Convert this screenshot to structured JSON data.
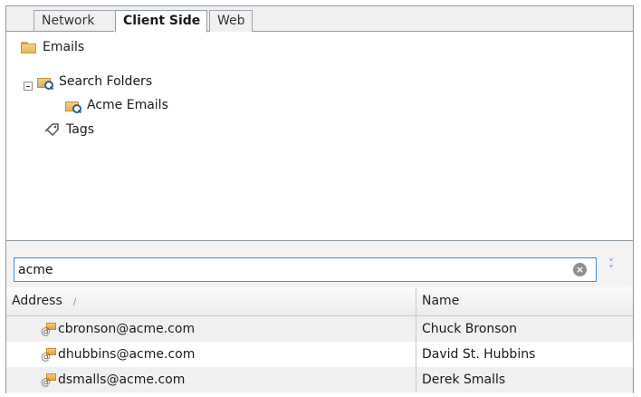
{
  "tabs": [
    {
      "label": "Network",
      "active": false
    },
    {
      "label": "Client Side",
      "active": true
    },
    {
      "label": "Web",
      "active": false
    }
  ],
  "tree": {
    "items": [
      {
        "label": "Emails",
        "icon": "folder-icon"
      },
      {
        "label": "Search Folders",
        "icon": "search-folder-icon",
        "expanded": true
      },
      {
        "label": "Acme Emails",
        "icon": "search-folder-icon"
      },
      {
        "label": "Tags",
        "icon": "tag-icon"
      }
    ]
  },
  "search": {
    "value": "acme"
  },
  "table": {
    "columns": [
      {
        "label": "Address",
        "sorted": "ascending"
      },
      {
        "label": "Name"
      }
    ],
    "rows": [
      {
        "address": "cbronson@acme.com",
        "name": "Chuck Bronson"
      },
      {
        "address": "dhubbins@acme.com",
        "name": "David St. Hubbins"
      },
      {
        "address": "dsmalls@acme.com",
        "name": "Derek Smalls"
      }
    ]
  },
  "colors": {
    "accent": "#3c8ad6",
    "folder": "#e3b45a",
    "border": "#8e9aa6"
  }
}
